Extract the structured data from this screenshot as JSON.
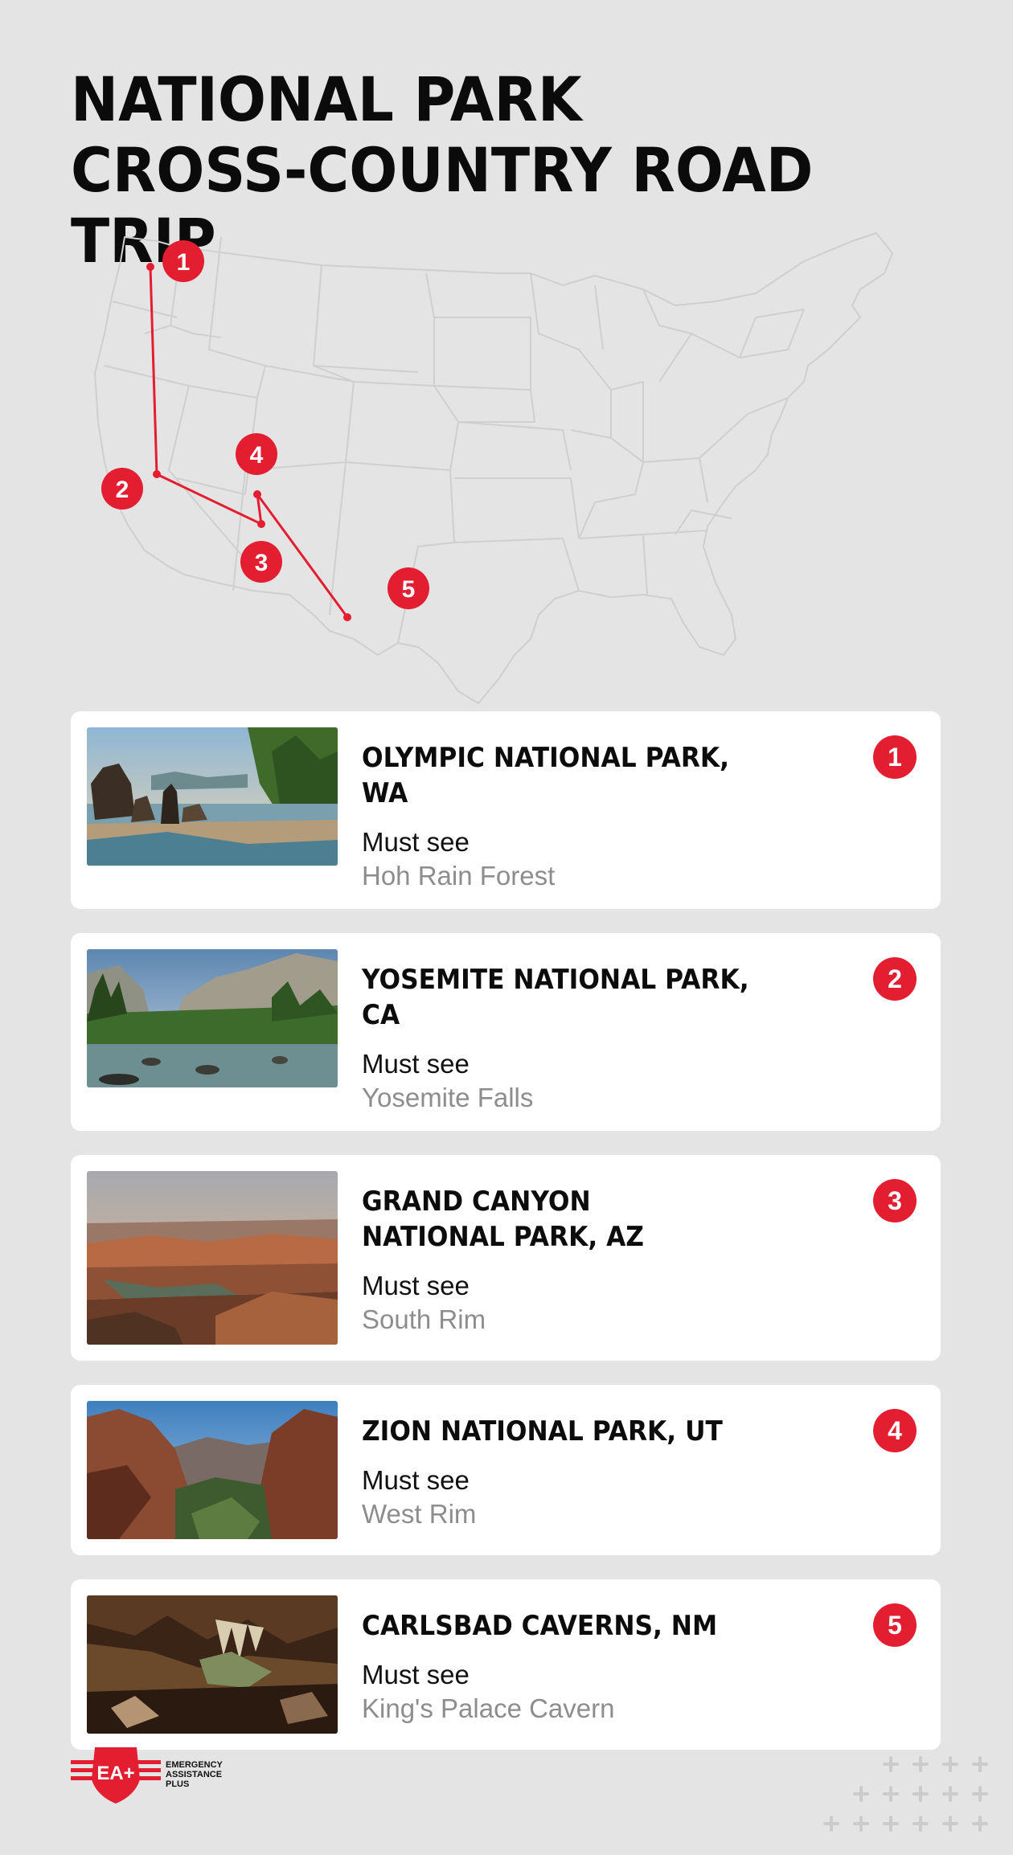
{
  "title": {
    "line1": "NATIONAL PARK",
    "line2": "CROSS-COUNTRY ROAD TRIP"
  },
  "colors": {
    "accent": "#e41e31",
    "background": "#e4e4e4",
    "map_lines": "#cfcfcf"
  },
  "map": {
    "markers": [
      "1",
      "2",
      "3",
      "4",
      "5"
    ]
  },
  "parks": [
    {
      "number": "1",
      "name": "OLYMPIC NATIONAL PARK, WA",
      "must_see_label": "Must see",
      "highlight": "Hoh Rain Forest",
      "photo": "coastal-sea-stacks"
    },
    {
      "number": "2",
      "name": "YOSEMITE NATIONAL PARK, CA",
      "must_see_label": "Must see",
      "highlight": "Yosemite Falls",
      "photo": "valley-river"
    },
    {
      "number": "3",
      "name": "GRAND CANYON\nNATIONAL PARK, AZ",
      "must_see_label": "Must see",
      "highlight": "South Rim",
      "photo": "canyon-river-bend"
    },
    {
      "number": "4",
      "name": "ZION NATIONAL PARK, UT",
      "must_see_label": "Must see",
      "highlight": "West Rim",
      "photo": "red-cliff-canyon"
    },
    {
      "number": "5",
      "name": "CARLSBAD CAVERNS, NM",
      "must_see_label": "Must see",
      "highlight": "King's Palace Cavern",
      "photo": "cave-formations"
    }
  ],
  "logo": {
    "mark": "EA+",
    "line1": "EMERGENCY",
    "line2": "ASSISTANCE",
    "line3": "PLUS"
  }
}
